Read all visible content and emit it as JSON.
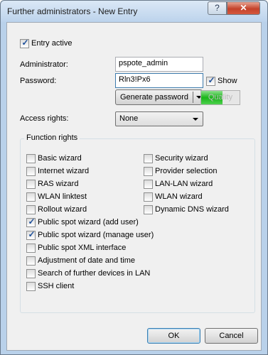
{
  "window": {
    "title": "Further administrators - New Entry",
    "help_label": "?",
    "close_label": "✕"
  },
  "entry_active": {
    "label": "Entry active",
    "checked": true
  },
  "administrator": {
    "label": "Administrator:",
    "value": "pspote_admin"
  },
  "password": {
    "label": "Password:",
    "value": "Rln3!Px6",
    "show_label": "Show",
    "show_checked": true,
    "generate_label": "Generate password",
    "quality_label": "Quality",
    "quality_level": 0.55
  },
  "access_rights": {
    "label": "Access rights:",
    "selected": "None"
  },
  "function_rights": {
    "title": "Function rights",
    "left_column": [
      {
        "label": "Basic wizard",
        "checked": false
      },
      {
        "label": "Internet wizard",
        "checked": false
      },
      {
        "label": "RAS wizard",
        "checked": false
      },
      {
        "label": "WLAN linktest",
        "checked": false
      },
      {
        "label": "Rollout wizard",
        "checked": false
      },
      {
        "label": "Public spot wizard (add user)",
        "checked": true
      },
      {
        "label": "Public spot wizard (manage user)",
        "checked": true
      },
      {
        "label": "Public spot XML interface",
        "checked": false
      },
      {
        "label": "Adjustment of date and time",
        "checked": false
      },
      {
        "label": "Search of further devices in LAN",
        "checked": false
      },
      {
        "label": "SSH client",
        "checked": false
      }
    ],
    "right_column": [
      {
        "label": "Security wizard",
        "checked": false
      },
      {
        "label": "Provider selection",
        "checked": false
      },
      {
        "label": "LAN-LAN wizard",
        "checked": false
      },
      {
        "label": "WLAN wizard",
        "checked": false
      },
      {
        "label": "Dynamic DNS wizard",
        "checked": false
      }
    ]
  },
  "buttons": {
    "ok": "OK",
    "cancel": "Cancel"
  }
}
